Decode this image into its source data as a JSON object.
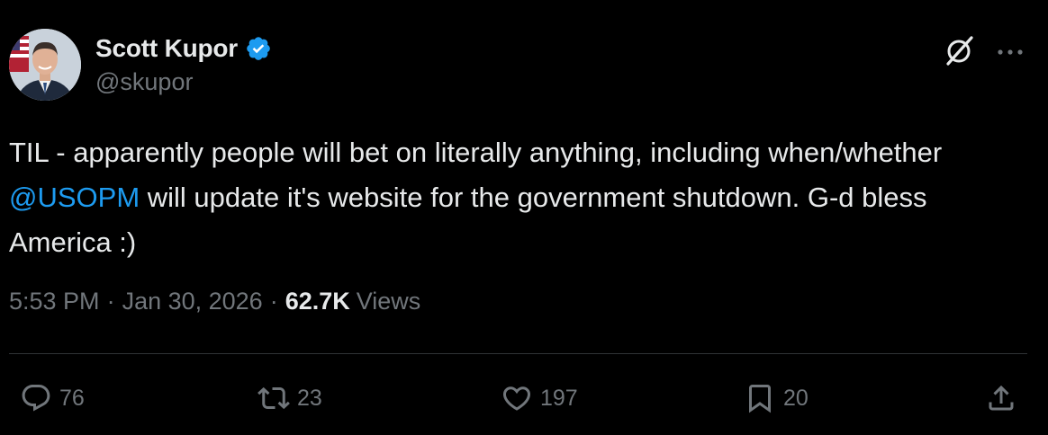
{
  "author": {
    "display_name": "Scott Kupor",
    "handle": "@skupor",
    "verified": true,
    "verified_color": "#1d9bf0"
  },
  "tweet": {
    "text_before": "TIL - apparently people will bet on literally anything, including when/whether ",
    "mention": "@USOPM",
    "text_after": " will update it's website for the government shutdown. G-d bless America :)",
    "time": "5:53 PM",
    "date": "Jan 30, 2026",
    "views_count": "62.7K",
    "views_label": "Views"
  },
  "stats": {
    "replies": "76",
    "reposts": "23",
    "likes": "197",
    "bookmarks": "20"
  },
  "icons": {
    "header": [
      "grok-icon",
      "more-icon"
    ],
    "actions": [
      "reply-icon",
      "repost-icon",
      "like-icon",
      "bookmark-icon",
      "share-icon"
    ]
  },
  "colors": {
    "background": "#000000",
    "text": "#e7e9ea",
    "muted": "#71767b",
    "link": "#1d9bf0",
    "divider": "#2f3336"
  }
}
